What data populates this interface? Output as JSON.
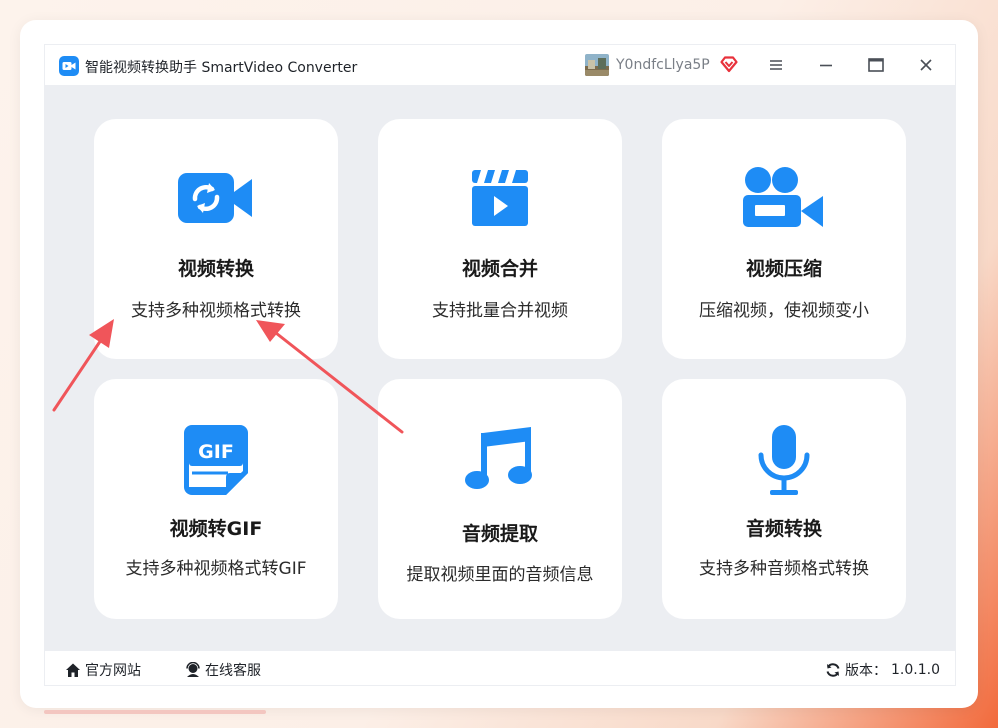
{
  "app": {
    "title": "智能视频转换助手 SmartVideo Converter",
    "username": "Y0ndfcLlya5P",
    "accent_color": "#1e8cf5",
    "annotation_color": "#f0555a"
  },
  "cards": [
    {
      "title": "视频转换",
      "desc": "支持多种视频格式转换",
      "icon": "video-convert-icon"
    },
    {
      "title": "视频合并",
      "desc": "支持批量合并视频",
      "icon": "clapperboard-icon"
    },
    {
      "title": "视频压缩",
      "desc": "压缩视频，使视频变小",
      "icon": "video-camera-icon"
    },
    {
      "title": "视频转GIF",
      "desc": "支持多种视频格式转GIF",
      "icon": "gif-file-icon",
      "icon_text": "GIF"
    },
    {
      "title": "音频提取",
      "desc": "提取视频里面的音频信息",
      "icon": "music-note-icon"
    },
    {
      "title": "音频转换",
      "desc": "支持多种音频格式转换",
      "icon": "microphone-icon"
    }
  ],
  "footer": {
    "website": "官方网站",
    "service": "在线客服",
    "version_label": "版本：",
    "version": "1.0.1.0"
  }
}
